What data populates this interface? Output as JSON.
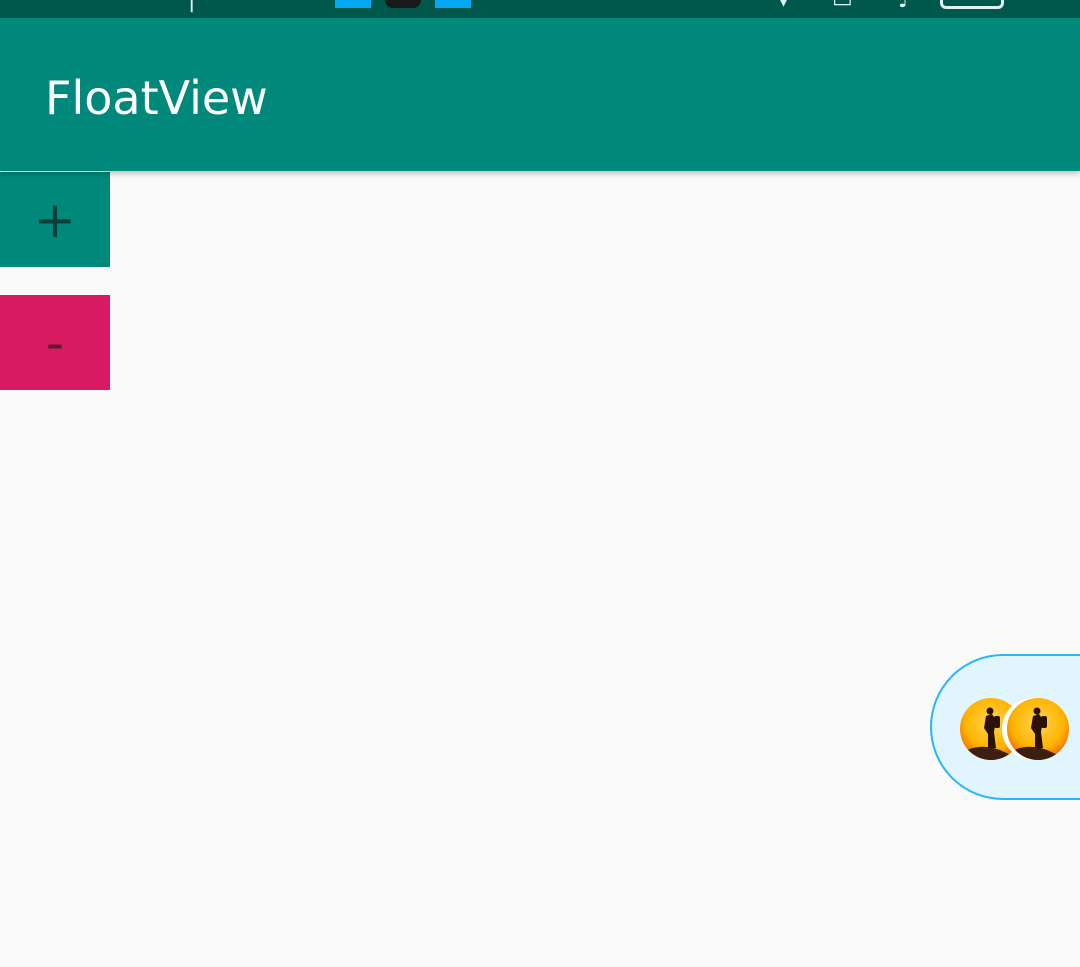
{
  "app_bar": {
    "title": "FloatView"
  },
  "buttons": {
    "add_label": "+",
    "remove_label": "-"
  },
  "float_view": {
    "avatars": [
      "avatar-hiker-sunset",
      "avatar-hiker-sunset"
    ]
  },
  "colors": {
    "status_bar": "#00574b",
    "primary": "#00897b",
    "accent": "#d81b60",
    "float_bg": "#e1f5fe",
    "float_border": "#29b6f6",
    "background": "#fafafa"
  }
}
